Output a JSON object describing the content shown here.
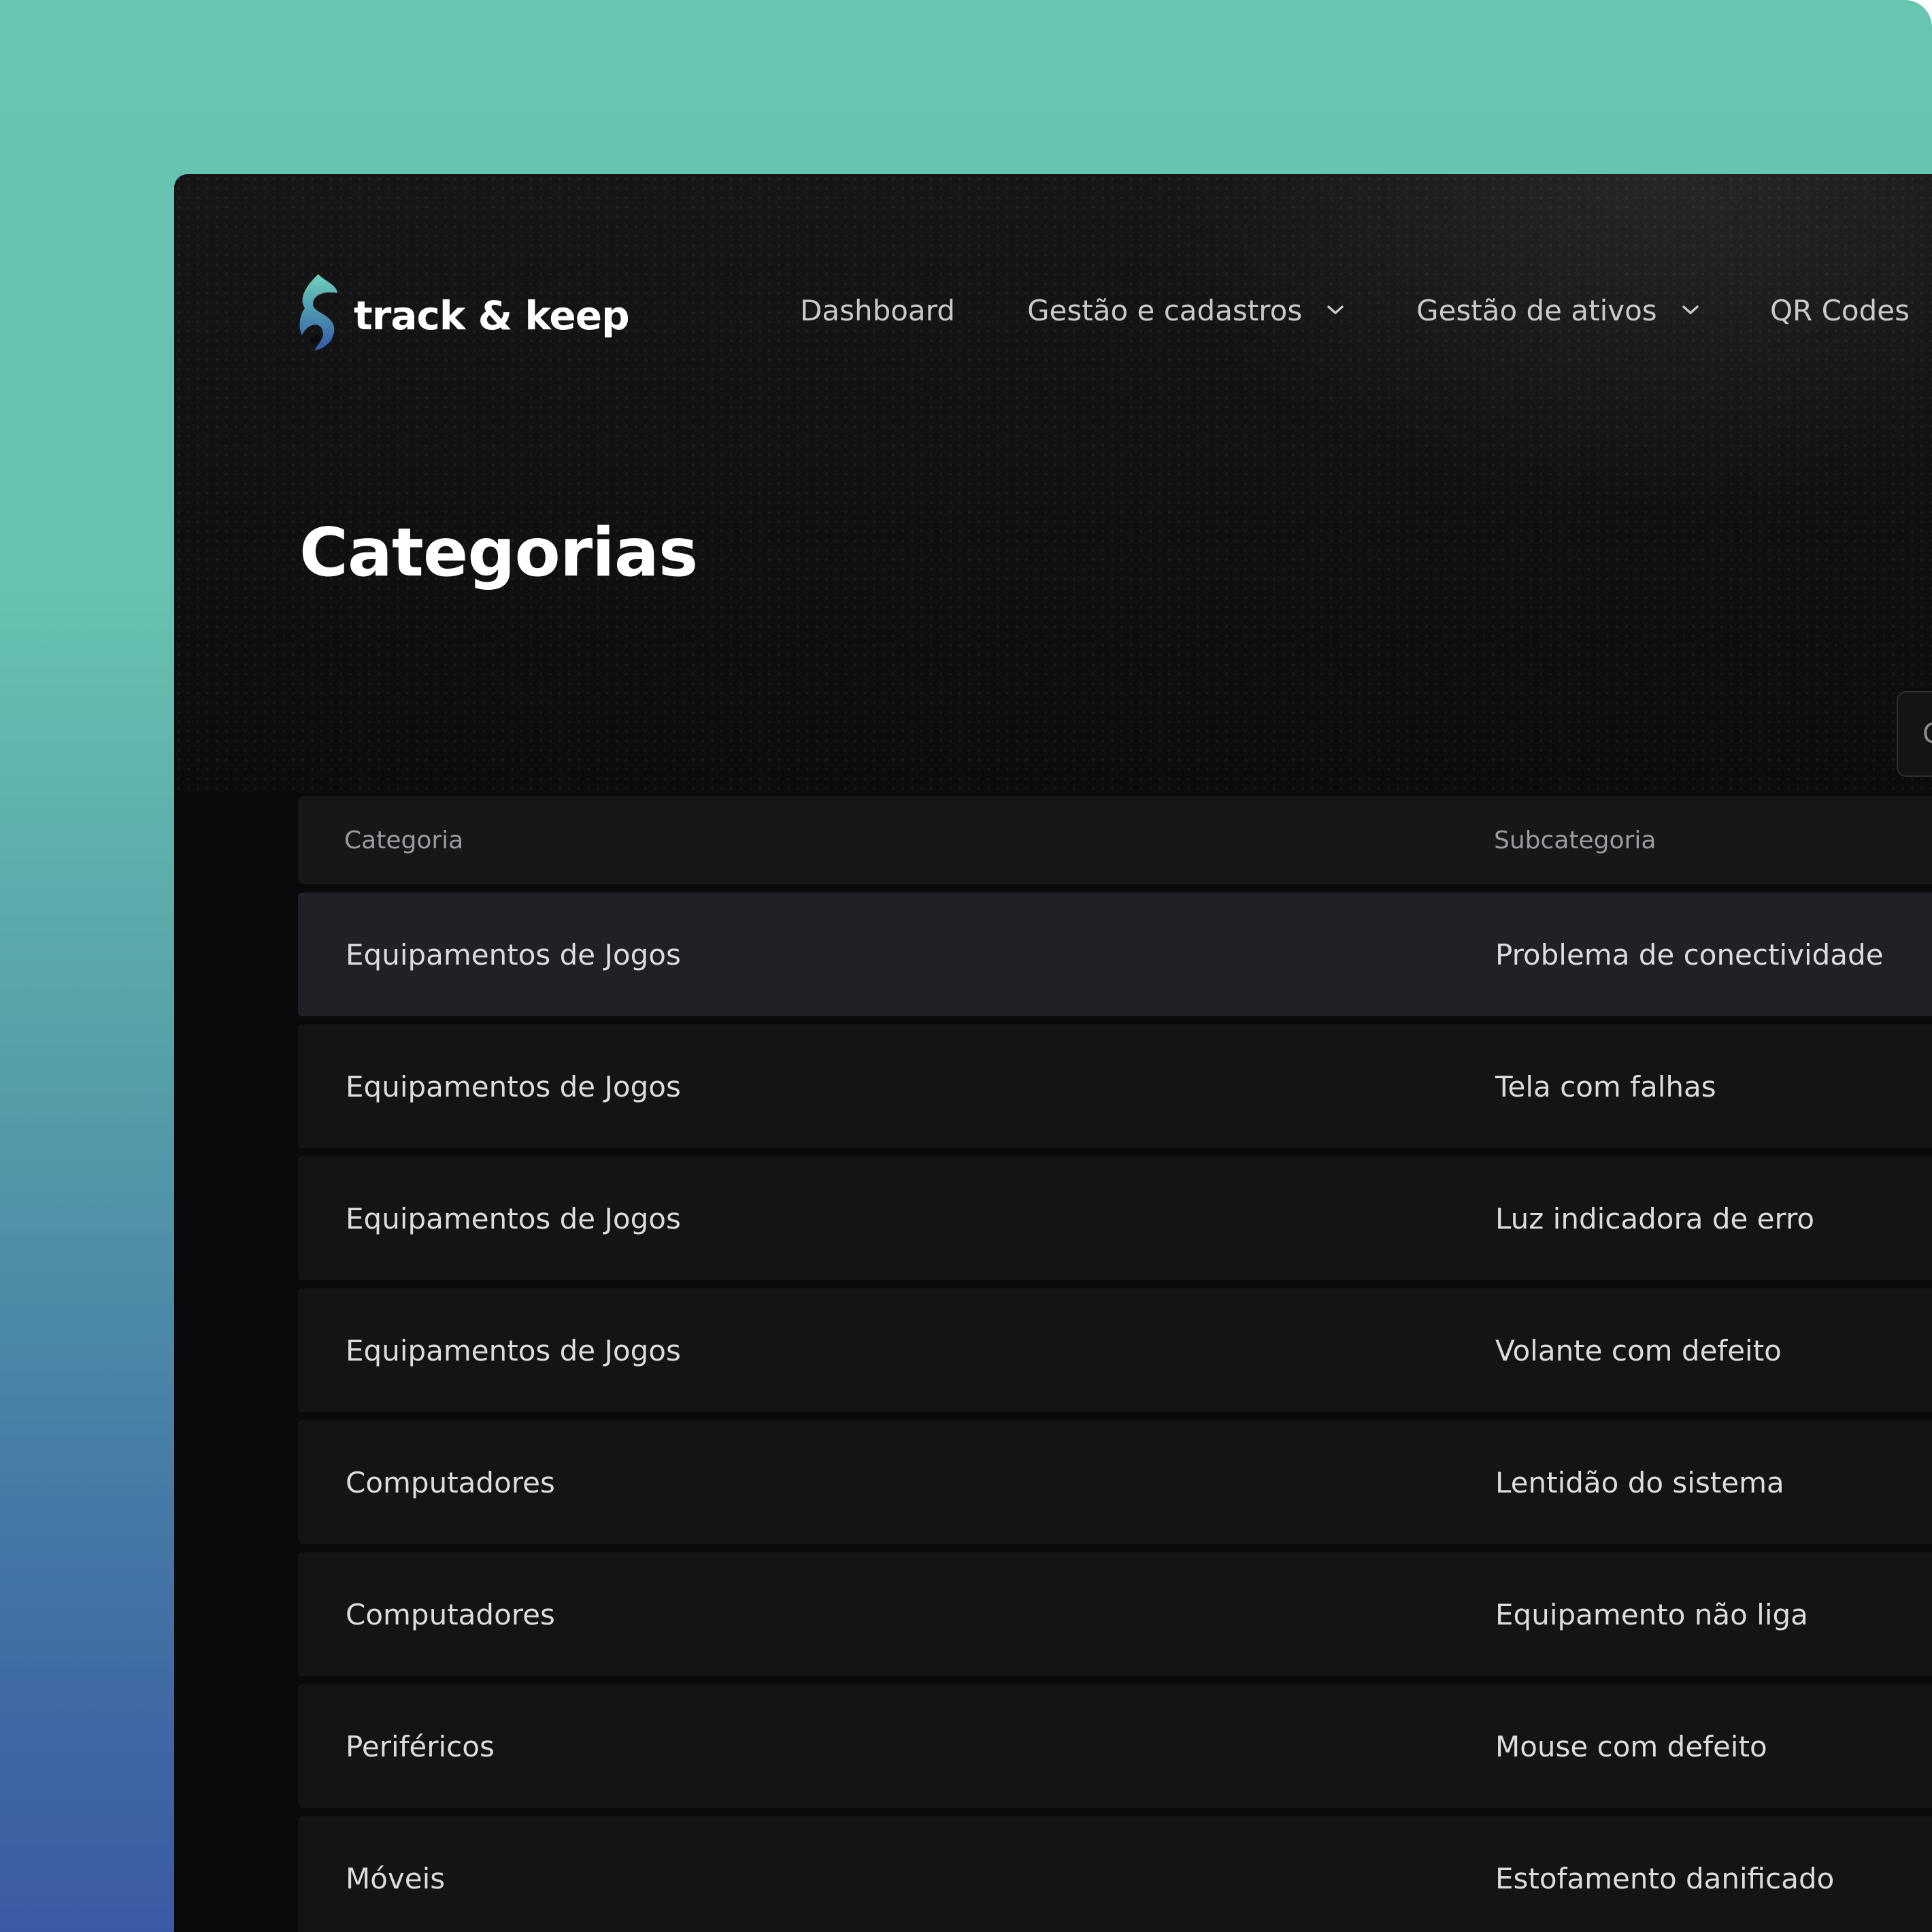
{
  "brand": {
    "name": "track & keep"
  },
  "nav": {
    "items": [
      {
        "label": "Dashboard",
        "dropdown": false
      },
      {
        "label": "Gestão e cadastros",
        "dropdown": true
      },
      {
        "label": "Gestão de ativos",
        "dropdown": true
      },
      {
        "label": "QR Codes",
        "dropdown": false
      }
    ]
  },
  "page": {
    "title": "Categorias"
  },
  "filter": {
    "label": "C"
  },
  "table": {
    "columns": [
      "Categoria",
      "Subcategoria"
    ],
    "rows": [
      {
        "categoria": "Equipamentos de Jogos",
        "subcategoria": "Problema de conectividade",
        "active": true
      },
      {
        "categoria": "Equipamentos de Jogos",
        "subcategoria": "Tela com falhas"
      },
      {
        "categoria": "Equipamentos de Jogos",
        "subcategoria": "Luz indicadora de erro"
      },
      {
        "categoria": "Equipamentos de Jogos",
        "subcategoria": "Volante com defeito"
      },
      {
        "categoria": "Computadores",
        "subcategoria": "Lentidão do sistema"
      },
      {
        "categoria": "Computadores",
        "subcategoria": "Equipamento não liga"
      },
      {
        "categoria": "Periféricos",
        "subcategoria": "Mouse com defeito"
      },
      {
        "categoria": "Móveis",
        "subcategoria": "Estofamento danificado"
      }
    ]
  },
  "colors": {
    "background_top": "#67c5b1",
    "background_bottom": "#3a5ba4",
    "app_bg": "#0a0a0c",
    "row_bg": "#141417",
    "row_active_bg": "#202026"
  }
}
